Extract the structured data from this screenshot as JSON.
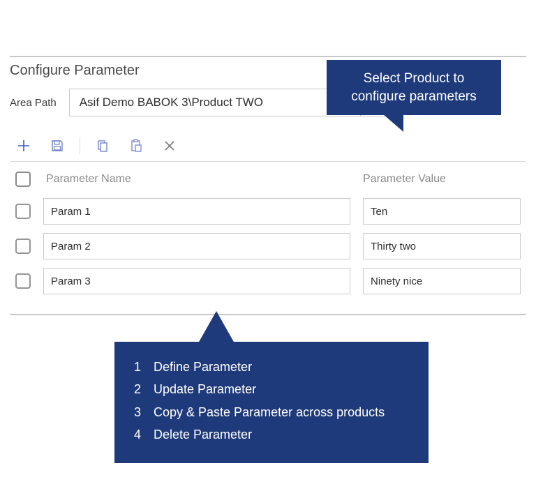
{
  "topCallout": "Select Product to configure parameters",
  "heading": "Configure Parameter",
  "areaPath": {
    "label": "Area Path",
    "value": "Asif Demo BABOK 3\\Product TWO"
  },
  "columns": {
    "name": "Parameter Name",
    "value": "Parameter Value"
  },
  "rows": [
    {
      "name": "Param 1",
      "value": "Ten"
    },
    {
      "name": "Param 2",
      "value": "Thirty two"
    },
    {
      "name": "Param 3",
      "value": "Ninety nice"
    }
  ],
  "bottomCallout": [
    {
      "n": "1",
      "t": "Define Parameter"
    },
    {
      "n": "2",
      "t": "Update Parameter"
    },
    {
      "n": "3",
      "t": "Copy & Paste Parameter across products"
    },
    {
      "n": "4",
      "t": "Delete Parameter"
    }
  ]
}
